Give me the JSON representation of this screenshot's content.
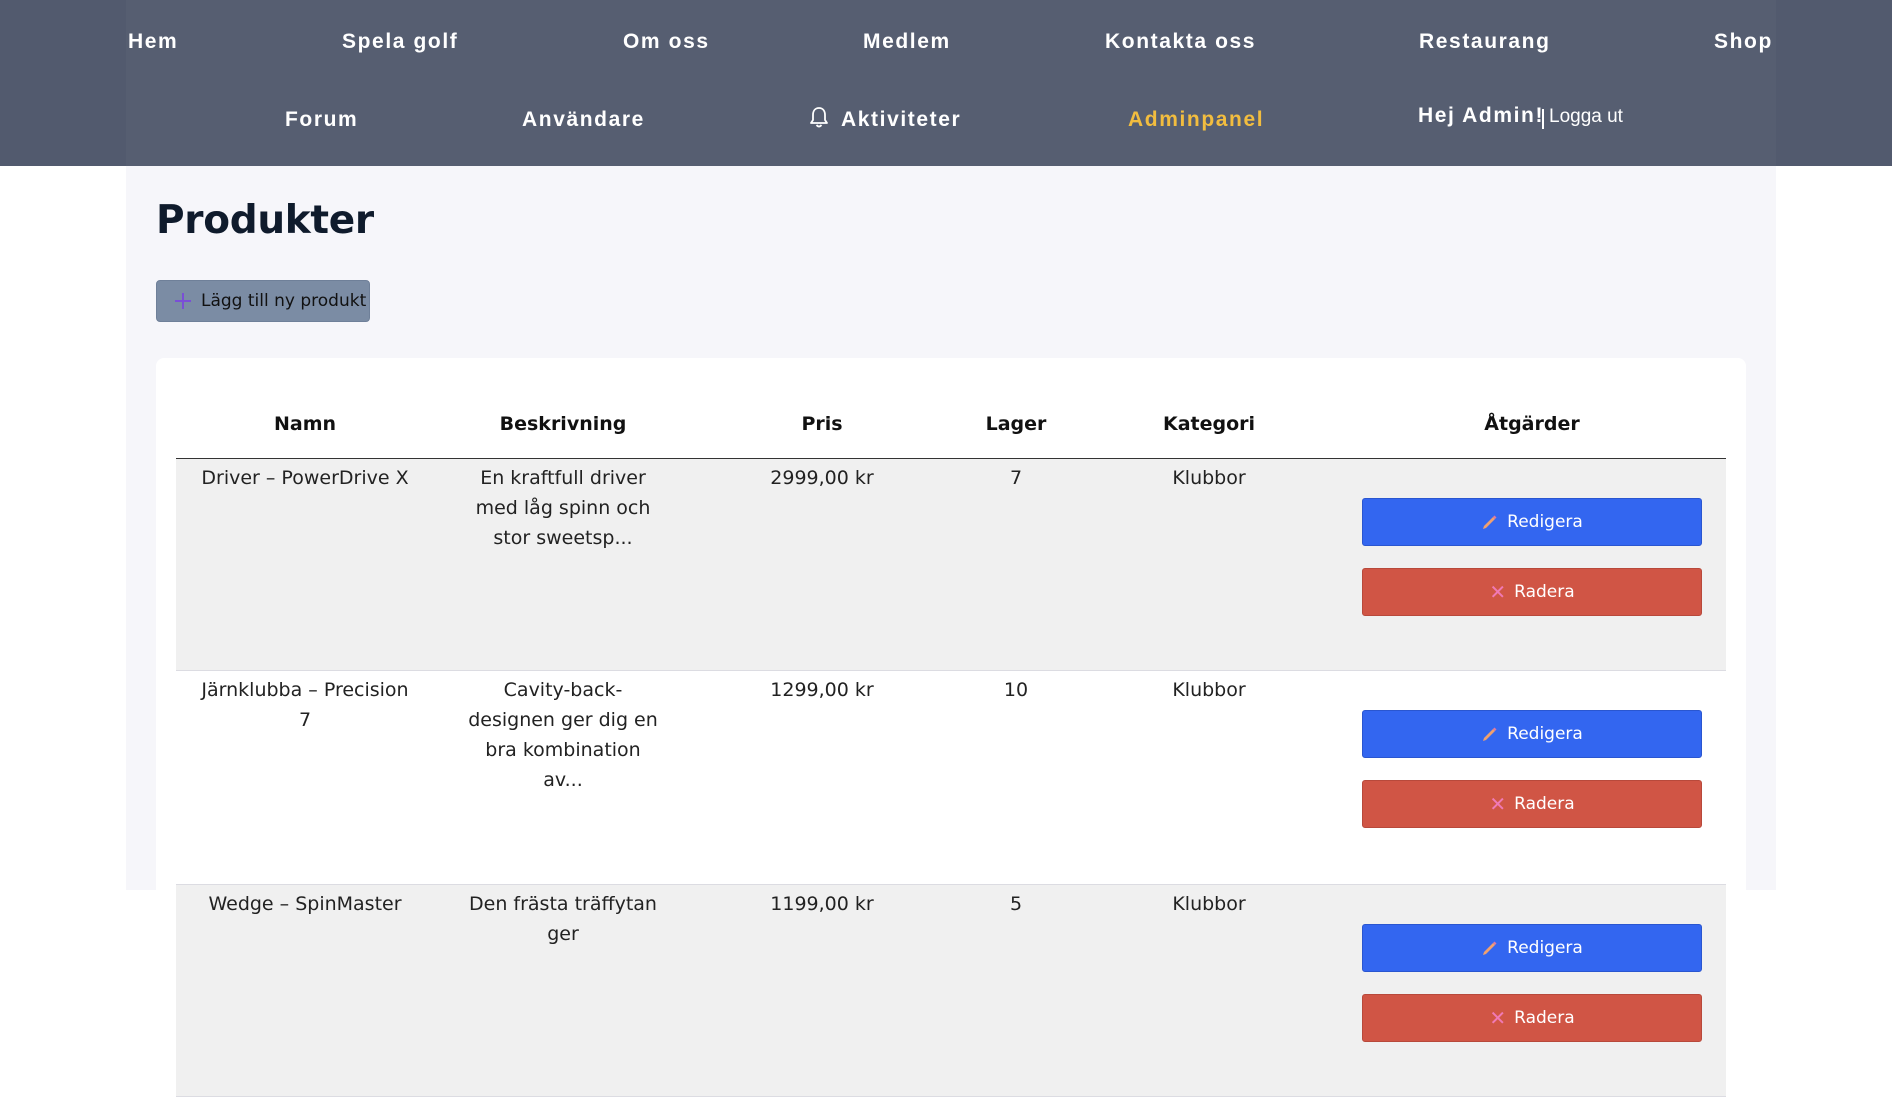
{
  "nav": {
    "row1": [
      "Hem",
      "Spela golf",
      "Om oss",
      "Medlem",
      "Kontakta oss",
      "Restaurang",
      "Shop"
    ],
    "row2": [
      "Forum",
      "Användare",
      "Aktiviteter",
      "Adminpanel"
    ],
    "greeting": "Hej Admin!",
    "logout": "Logga ut",
    "active_color": "#f2bd3f",
    "icons": {
      "aktiviteter": "bell-icon"
    }
  },
  "page": {
    "title": "Produkter",
    "add_button": "Lägg till ny produkt"
  },
  "table": {
    "headers": [
      "Namn",
      "Beskrivning",
      "Pris",
      "Lager",
      "Kategori",
      "Åtgärder"
    ],
    "rows": [
      {
        "name": "Driver – PowerDrive X",
        "description": "En kraftfull driver med låg spinn och stor sweetsp...",
        "price": "2999,00 kr",
        "stock": "7",
        "category": "Klubbor"
      },
      {
        "name": "Järnklubba – Precision 7",
        "description": "Cavity-back-designen ger dig en bra kombination av...",
        "price": "1299,00 kr",
        "stock": "10",
        "category": "Klubbor"
      },
      {
        "name": "Wedge – SpinMaster",
        "description": "Den frästa träffytan ger",
        "price": "1199,00 kr",
        "stock": "5",
        "category": "Klubbor"
      }
    ],
    "edit_label": "Redigera",
    "delete_label": "Radera"
  },
  "colors": {
    "nav_bg": "#565e71",
    "edit": "#3366f0",
    "delete": "#d05545"
  }
}
